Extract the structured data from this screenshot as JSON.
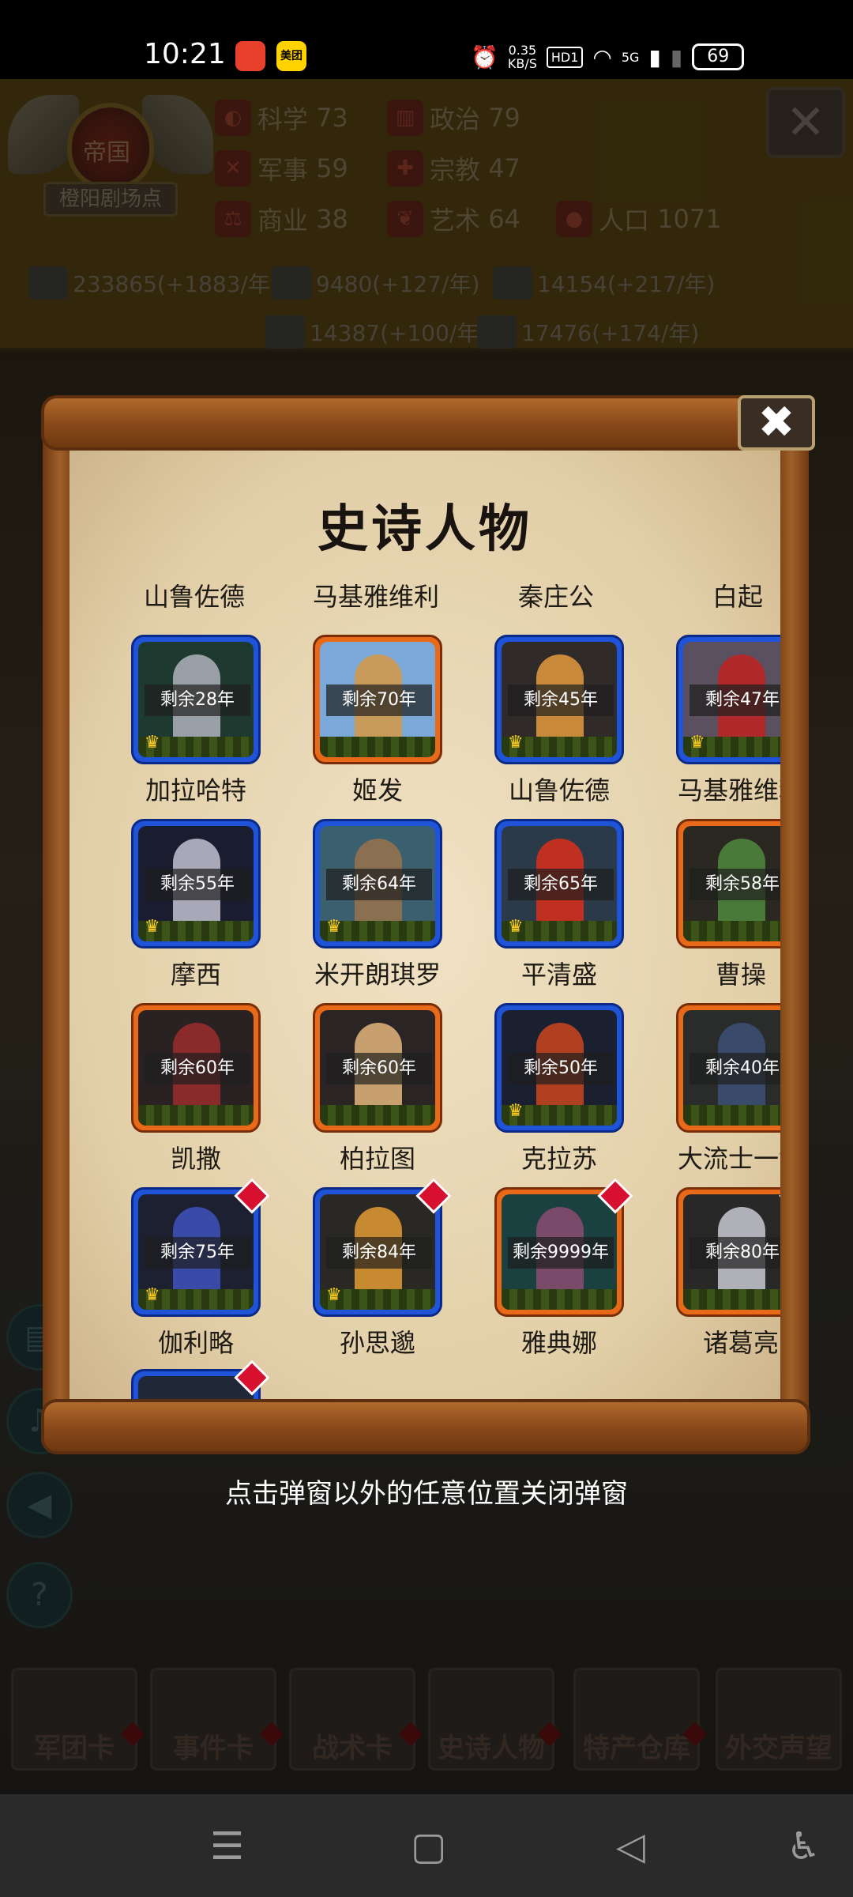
{
  "status_bar": {
    "time": "10:21",
    "app_icons": [
      "weibo-icon",
      "meituan-icon"
    ],
    "meituan_label": "美团",
    "speed_value": "0.35",
    "speed_unit": "KB/S",
    "hd_label": "HD1",
    "network": "5G",
    "battery": "69"
  },
  "empire": {
    "title": "帝国",
    "subtitle": "橙阳剧场点"
  },
  "stats": [
    {
      "label": "科学",
      "value": "73"
    },
    {
      "label": "政治",
      "value": "79"
    },
    {
      "label": "军事",
      "value": "59"
    },
    {
      "label": "宗教",
      "value": "47"
    },
    {
      "label": "商业",
      "value": "38"
    },
    {
      "label": "艺术",
      "value": "64"
    },
    {
      "label": "人口",
      "value": "1071"
    }
  ],
  "resources": [
    {
      "text": "233865(+1883/年)"
    },
    {
      "text": "9480(+127/年)"
    },
    {
      "text": "14154(+217/年)"
    },
    {
      "text": "14387(+100/年)"
    },
    {
      "text": "17476(+174/年)"
    }
  ],
  "dialog": {
    "title": "史诗人物",
    "header_names": [
      "山鲁佐德",
      "马基雅维利",
      "秦庄公",
      "白起"
    ],
    "cards": [
      {
        "name": "加拉哈特",
        "remain": "剩余28年",
        "frame": "blue",
        "crown": true,
        "badge": false,
        "bg": "#1e3a30",
        "fig": "#9aa0a8"
      },
      {
        "name": "姬发",
        "remain": "剩余70年",
        "frame": "orange",
        "crown": false,
        "badge": false,
        "bg": "#7aa8d8",
        "fig": "#c89a5a"
      },
      {
        "name": "山鲁佐德",
        "remain": "剩余45年",
        "frame": "blue",
        "crown": true,
        "badge": false,
        "bg": "#302a28",
        "fig": "#c88a3a"
      },
      {
        "name": "马基雅维利",
        "remain": "剩余47年",
        "frame": "blue",
        "crown": true,
        "badge": false,
        "bg": "#5a5060",
        "fig": "#b0282a"
      },
      {
        "name": "摩西",
        "remain": "剩余55年",
        "frame": "blue",
        "crown": true,
        "badge": false,
        "bg": "#1a1c30",
        "fig": "#a8a8b8"
      },
      {
        "name": "米开朗琪罗",
        "remain": "剩余64年",
        "frame": "blue",
        "crown": true,
        "badge": false,
        "bg": "#3a6070",
        "fig": "#8a7050"
      },
      {
        "name": "平清盛",
        "remain": "剩余65年",
        "frame": "blue",
        "crown": true,
        "badge": false,
        "bg": "#2a3a48",
        "fig": "#c03020"
      },
      {
        "name": "曹操",
        "remain": "剩余58年",
        "frame": "orange",
        "crown": false,
        "badge": false,
        "bg": "#2a2820",
        "fig": "#4a7a3a"
      },
      {
        "name": "凯撒",
        "remain": "剩余60年",
        "frame": "orange",
        "crown": false,
        "badge": false,
        "bg": "#2a2222",
        "fig": "#8a2a2a"
      },
      {
        "name": "柏拉图",
        "remain": "剩余60年",
        "frame": "orange",
        "crown": false,
        "badge": false,
        "bg": "#2a2424",
        "fig": "#c8a070"
      },
      {
        "name": "克拉苏",
        "remain": "剩余50年",
        "frame": "blue",
        "crown": true,
        "badge": false,
        "bg": "#1a2030",
        "fig": "#b04020"
      },
      {
        "name": "大流士一世",
        "remain": "剩余40年",
        "frame": "orange",
        "crown": false,
        "badge": false,
        "bg": "#2a2c2c",
        "fig": "#3a4a6a"
      },
      {
        "name": "伽利略",
        "remain": "剩余75年",
        "frame": "blue",
        "crown": true,
        "badge": true,
        "bg": "#1c2030",
        "fig": "#3a4aa8"
      },
      {
        "name": "孙思邈",
        "remain": "剩余84年",
        "frame": "blue",
        "crown": true,
        "badge": true,
        "bg": "#2a2824",
        "fig": "#c88a30"
      },
      {
        "name": "雅典娜",
        "remain": "剩余9999年",
        "frame": "orange",
        "crown": false,
        "badge": true,
        "bg": "#1a4040",
        "fig": "#7a4a6a"
      },
      {
        "name": "诸葛亮",
        "remain": "剩余80年",
        "frame": "orange",
        "crown": false,
        "badge": true,
        "bg": "#282828",
        "fig": "#b0b0b8"
      }
    ]
  },
  "hint": "点击弹窗以外的任意位置关闭弹窗",
  "bottom_tabs": [
    "军团卡",
    "事件卡",
    "战术卡",
    "史诗人物",
    "特产仓库",
    "外交声望"
  ],
  "nav": {
    "menu_glyph": "☰",
    "home_glyph": "▢",
    "back_glyph": "◁",
    "accessibility_glyph": "♿"
  }
}
